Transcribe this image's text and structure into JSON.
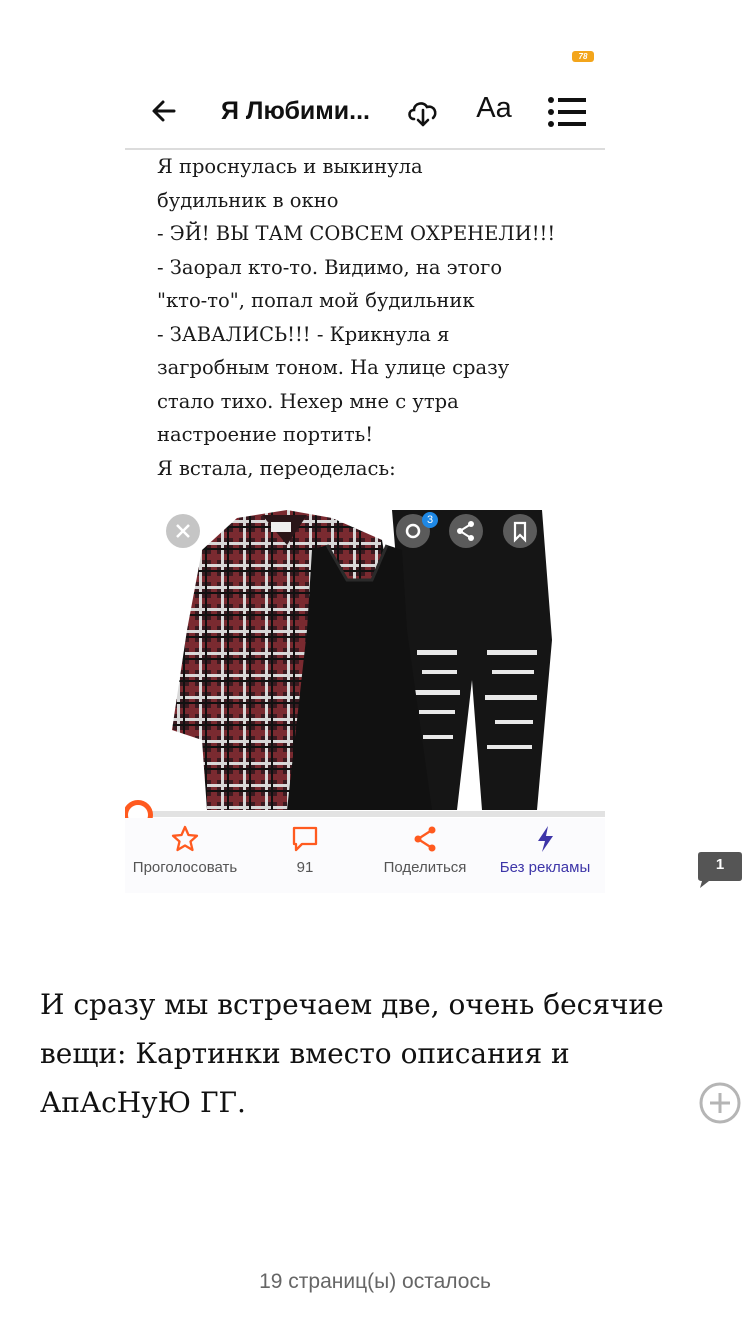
{
  "status_bar": {
    "battery": "78"
  },
  "reader": {
    "book_title": "Я Любими...",
    "font_button": "Aa",
    "story_text": "Я проснулась и выкинула\nбудильник в окно\n- ЭЙ! ВЫ ТАМ СОВСЕМ ОХРЕНЕЛИ!!!\n- Заорал кто-то. Видимо, на этого\n\"кто-то\", попал мой будильник\n- ЗАВАЛИСЬ!!! - Крикнула я\nзагробным тоном. На улице сразу\nстало тихо. Нехер мне с утра\nнастроение портить!\nЯ встала, переоделась:",
    "image_badge": "3",
    "actions": {
      "vote": "Проголосовать",
      "comments_count": "91",
      "share": "Поделиться",
      "no_ads": "Без рекламы"
    }
  },
  "note_count": "1",
  "comment_text": "И сразу мы встречаем две, очень бесячие вещи: Картинки вместо описания и АпАсНуЮ ГГ.",
  "pages_left": "19 страниц(ы) осталось",
  "colors": {
    "accent": "#ff5a1f",
    "premium": "#3d35a8",
    "badge": "#1e88e5"
  }
}
